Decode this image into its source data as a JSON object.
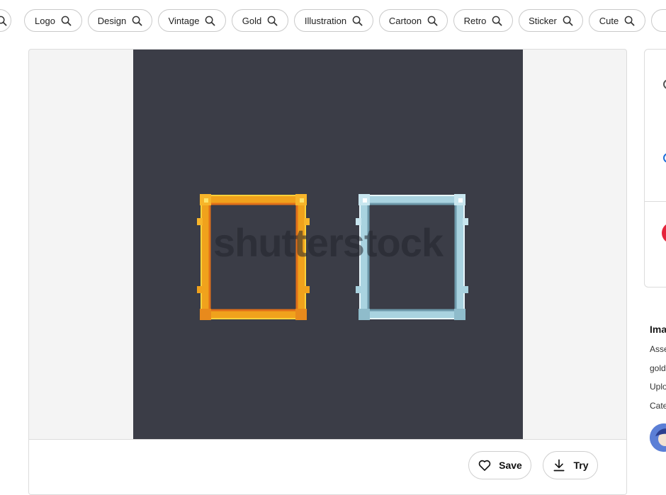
{
  "chips": [
    {
      "label": ""
    },
    {
      "label": "Logo"
    },
    {
      "label": "Design"
    },
    {
      "label": "Vintage"
    },
    {
      "label": "Gold"
    },
    {
      "label": "Illustration"
    },
    {
      "label": "Cartoon"
    },
    {
      "label": "Retro"
    },
    {
      "label": "Sticker"
    },
    {
      "label": "Cute"
    }
  ],
  "preview": {
    "watermark": "shutterstock",
    "background_color": "#3b3d47",
    "frames": [
      {
        "name": "gold-frame",
        "color": "#f0a21c"
      },
      {
        "name": "silver-frame",
        "color": "#a9d3e0"
      }
    ]
  },
  "actions": {
    "save_label": "Save",
    "try_label": "Try"
  },
  "details": {
    "title": "Ima",
    "lines": [
      "Asse",
      "gold",
      "Uplo",
      "Cate"
    ]
  },
  "colors": {
    "accent_red": "#e5233b",
    "accent_blue": "#1e6fd9"
  }
}
